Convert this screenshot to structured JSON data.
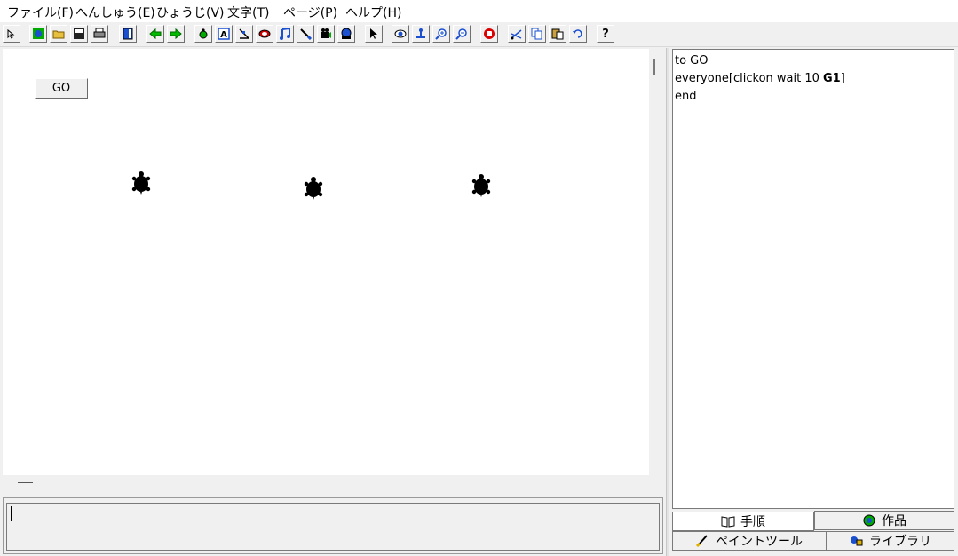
{
  "menu": [
    {
      "label": "ファイル(F)"
    },
    {
      "label": "へんしゅう(E)"
    },
    {
      "label": "ひょうじ(V)"
    },
    {
      "label": "文字(T)"
    },
    {
      "label": "ページ(P)"
    },
    {
      "label": "ヘルプ(H)"
    }
  ],
  "toolbar": {
    "icons": [
      "select-arrow-icon",
      "globe-icon",
      "open-folder-icon",
      "save-icon",
      "print-icon",
      "book-icon",
      "back-arrow-icon",
      "forward-arrow-icon",
      "new-turtle-icon",
      "text-box-icon",
      "slider-icon",
      "button-icon",
      "music-icon",
      "paint-brush-icon",
      "video-icon",
      "network-icon",
      "pointer-icon",
      "eye-icon",
      "stamp-icon",
      "zoom-in-icon",
      "zoom-out-icon",
      "hand-stop-icon",
      "scissors-icon",
      "copy-icon",
      "paste-icon",
      "undo-icon",
      "help-icon"
    ],
    "help_label": "?"
  },
  "canvas": {
    "go_button_label": "GO",
    "turtle_count": 3
  },
  "procedures": {
    "line1": "to GO",
    "line2_plain": "everyone[clickon wait 10 ",
    "line2_bold": "G1",
    "line2_end": "]",
    "line3": "end"
  },
  "tabs": {
    "procedures": "手順",
    "project": "作品",
    "paint": "ペイントツール",
    "library": "ライブラリ"
  }
}
